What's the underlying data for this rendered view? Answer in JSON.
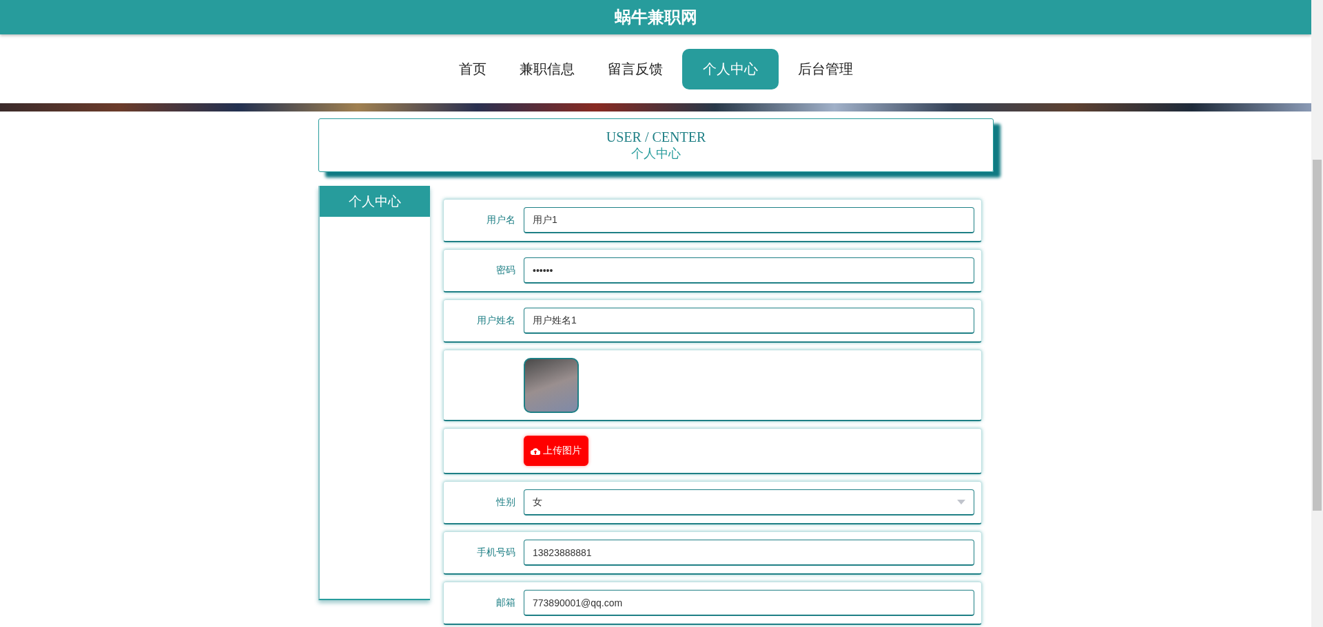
{
  "site_title": "蜗牛兼职网",
  "nav": [
    {
      "label": "首页",
      "selected": false
    },
    {
      "label": "兼职信息",
      "selected": false
    },
    {
      "label": "留言反馈",
      "selected": false
    },
    {
      "label": "个人中心",
      "selected": true
    },
    {
      "label": "后台管理",
      "selected": false
    }
  ],
  "section_header": {
    "title_en": "USER / CENTER",
    "title_zh": "个人中心"
  },
  "sidebar": {
    "title": "个人中心"
  },
  "form": [
    {
      "kind": "text",
      "label": "用户名",
      "value": "用户1"
    },
    {
      "kind": "text",
      "label": "密码",
      "value": "••••••"
    },
    {
      "kind": "text",
      "label": "用户姓名",
      "value": "用户姓名1"
    },
    {
      "kind": "image"
    },
    {
      "kind": "upload",
      "button": "上传图片"
    },
    {
      "kind": "select",
      "label": "性别",
      "value": "女"
    },
    {
      "kind": "text",
      "label": "手机号码",
      "value": "13823888881"
    },
    {
      "kind": "text",
      "label": "邮箱",
      "value": "773890001@qq.com"
    }
  ]
}
